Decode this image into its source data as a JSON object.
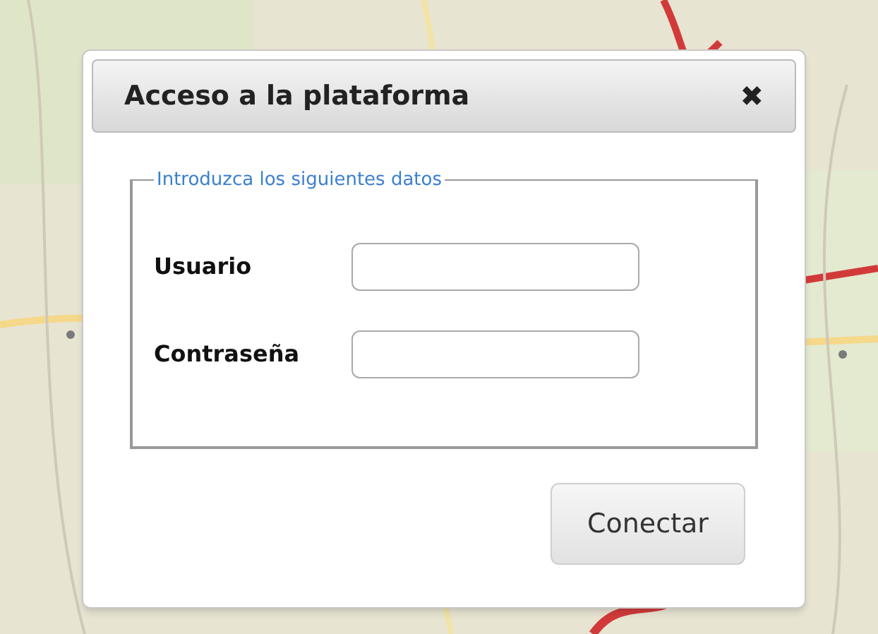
{
  "dialog": {
    "title": "Acceso a la plataforma",
    "close": "✖",
    "form": {
      "legend": "Introduzca los siguientes datos",
      "fields": [
        {
          "label": "Usuario"
        },
        {
          "label": "Contraseña"
        }
      ]
    },
    "submit": "Conectar"
  }
}
